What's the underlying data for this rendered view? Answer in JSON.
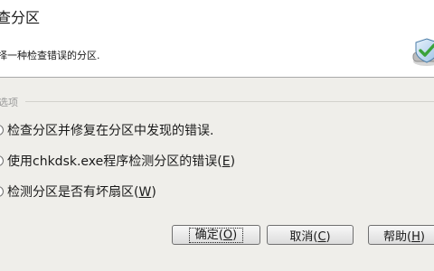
{
  "dialog": {
    "title": "查分区",
    "subtitle": "择一种检查错误的分区.",
    "icon": "check-disk-icon",
    "group_label": "选项",
    "options": [
      {
        "label": "检查分区并修复在分区中发现的错误.",
        "selected": false
      },
      {
        "label_prefix": "使用chkdsk.exe程序检测分区的错误(",
        "mnemonic": "E",
        "label_suffix": ")",
        "selected": false
      },
      {
        "label_prefix": "检测分区是否有坏扇区(",
        "mnemonic": "W",
        "label_suffix": ")",
        "selected": false
      }
    ],
    "buttons": {
      "ok": {
        "prefix": "确定(",
        "mnemonic": "O",
        "suffix": ")"
      },
      "cancel": {
        "prefix": "取消(",
        "mnemonic": "C",
        "suffix": ")"
      },
      "help": {
        "prefix": "帮助(",
        "mnemonic": "H",
        "suffix": ")"
      }
    }
  },
  "colors": {
    "header_bg": "#ffffff",
    "body_bg": "#efeeea",
    "group_label": "#9a9a9a",
    "icon_green": "#3aa23a",
    "icon_blue": "#7fb3df"
  }
}
